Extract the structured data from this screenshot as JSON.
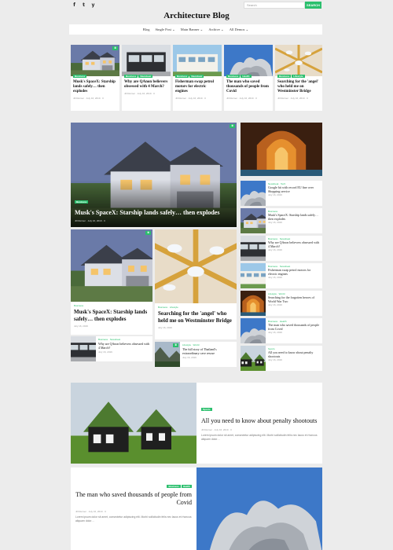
{
  "header": {
    "social": [
      "f",
      "t",
      "y"
    ],
    "search_placeholder": "Search",
    "search_button": "SEARCH",
    "site_title": "Architecture Blog",
    "nav": [
      "Blog",
      "Single Post ⌄",
      "Main Banner ⌄",
      "Archive ⌄",
      "All Demos ⌄"
    ]
  },
  "top_row": [
    {
      "tags": [
        "Business"
      ],
      "title": "Musk's SpaceX: Starship lands safely… then explodes",
      "meta": "Jill Reimer · July 16, 2019 · 0",
      "camera": true
    },
    {
      "tags": [
        "Business",
        "Newsbeat"
      ],
      "title": "Why are QAnon believers obsessed with 4 March?",
      "meta": "Jill Reimer · July 16, 2019 · 0",
      "camera": false
    },
    {
      "tags": [
        "Business",
        "Newsbeat"
      ],
      "title": "Fisherman swap petrol motors for electric engines",
      "meta": "Jill Reimer · July 16, 2019 · 0",
      "camera": false
    },
    {
      "tags": [
        "Business",
        "Health"
      ],
      "title": "The man who saved thousands of people from Covid",
      "meta": "Jill Reimer · July 16, 2019 · 0",
      "camera": false
    },
    {
      "tags": [
        "Business",
        "Lifestyle"
      ],
      "title": "Searching for the 'angel' who held me on Westminster Bridge",
      "meta": "Jill Reimer · July 16, 2019 · 0",
      "camera": false
    }
  ],
  "hero": {
    "tag": "Business",
    "title": "Musk's SpaceX: Starship lands safely… then explodes",
    "meta": "Jill Reimer · July 16, 2019 · 0"
  },
  "mid_left": {
    "cat": "Business",
    "title": "Musk's SpaceX: Starship lands safely… then explodes",
    "meta": "July 16, 2019"
  },
  "mid_right": {
    "cat": "Business · Lifestyle",
    "title": "Searching for the 'angel' who held me on Westminster Bridge",
    "meta": "July 16, 2019"
  },
  "small_left": {
    "cat": "Business · Newsbeat",
    "title": "Why are QAnon believers obsessed with 4 March?",
    "meta": "July 16, 2019"
  },
  "small_right": {
    "cat": "Lifestyle · World",
    "title": "The full story of Thailand's extraordinary cave rescue",
    "meta": "July 16, 2019"
  },
  "sidebar": [
    {
      "cat": "Newsbeat · Tech",
      "title": "Google hit with record EU fine over Shopping service",
      "meta": "July 16, 2019"
    },
    {
      "cat": "Business",
      "title": "Musk's SpaceX: Starship lands safely… then explodes",
      "meta": "July 16, 2019"
    },
    {
      "cat": "Business · Newsbeat",
      "title": "Why are QAnon believers obsessed with 4 March?",
      "meta": "July 16, 2019"
    },
    {
      "cat": "Business · Newsbeat",
      "title": "Fisherman swap petrol motors for electric engines",
      "meta": "July 16, 2019"
    },
    {
      "cat": "Lifestyle · World",
      "title": "Searching for the forgotten heroes of World War Two",
      "meta": "July 16, 2019"
    },
    {
      "cat": "Business · Health",
      "title": "The man who saved thousands of people from Covid",
      "meta": "July 16, 2019"
    },
    {
      "cat": "Sports",
      "title": "All you need to know about penalty shootouts",
      "meta": "July 16, 2019"
    }
  ],
  "feature1": {
    "tag": "Sports",
    "title": "All you need to know about penalty shootouts",
    "meta": "Jill Reimer · July 16, 2019 · 0",
    "excerpt": "Lorem ipsum dolor sit amet, consectetur adipiscing elit. Morbi sollicitudin felis nec lacus et rhoncus aliquam dolor…"
  },
  "feature2": {
    "tags": [
      "Business",
      "Health"
    ],
    "title": "The man who saved thousands of people from Covid",
    "meta": "Jill Reimer · July 16, 2019 · 0",
    "excerpt": "Lorem ipsum dolor sit amet, consectetur adipiscing elit. Morbi sollicitudin felis nec lacus et rhoncus aliquam dolor…"
  },
  "colors": {
    "accent": "#2bbf6d"
  }
}
